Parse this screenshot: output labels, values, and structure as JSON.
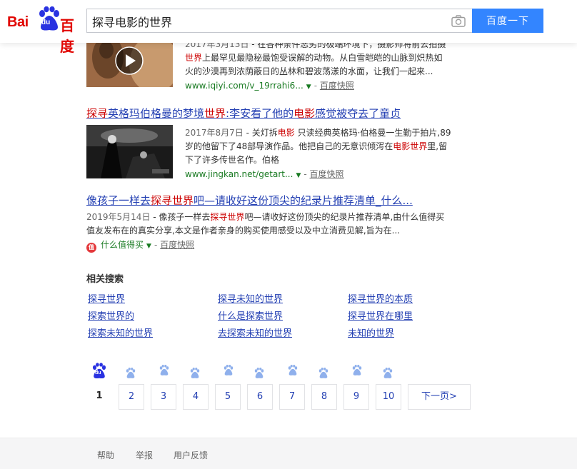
{
  "header": {
    "logo_bai": "Bai",
    "logo_du": "du",
    "logo_cn": "百度",
    "query": "探寻电影的世界",
    "search_button": "百度一下"
  },
  "results": [
    {
      "date": "2017年3月13日",
      "abstract_lines": [
        " - 在各种条件恶劣的极端环境下，摄影师将前去拍摄",
        "世界上最罕见最隐秘最饱受误解的动物。从白雪皑皑的山脉到炽热如",
        "火的沙漠再到浓荫蔽日的丛林和碧波荡漾的水面，让我们一起来..."
      ],
      "abstract_em": "世界",
      "url": "www.iqiyi.com/v_19rrahi6...",
      "snapshot": "百度快照"
    },
    {
      "title_parts": [
        "探寻",
        "英格玛伯格曼的梦境",
        "世界",
        ":李安看了他的",
        "电影",
        "感觉被夺去了童贞"
      ],
      "date": "2017年8月7日",
      "abstract_lines": [
        " - 关灯拆电影 只读经典英格玛·伯格曼一生勤于拍片,89",
        "岁的他留下了48部导演作品。他把自己的无意识倾泻在电影世界里,留",
        "下了许多传世名作。伯格"
      ],
      "url": "www.jingkan.net/getart...",
      "snapshot": "百度快照"
    },
    {
      "title_parts": [
        "像孩子一样去",
        "探寻世界",
        "吧—请收好这份顶尖的纪录片推荐清单_什么..."
      ],
      "date": "2019年5月14日",
      "abstract_lines": [
        " - 像孩子一样去探寻世界吧—请收好这份顶尖的纪录片推荐清单,由什么值得买",
        "值友发布在的真实分享,本文是作者亲身的购买使用感受以及中立消费见解,旨为在..."
      ],
      "source_icon": "值",
      "source_name": "什么值得买",
      "snapshot": "百度快照"
    }
  ],
  "related": {
    "title": "相关搜索",
    "items": [
      "探寻世界",
      "探寻未知的世界",
      "探寻世界的本质",
      "探索世界的",
      "什么是探索世界",
      "探寻世界在哪里",
      "探索未知的世界",
      "去探索未知的世界",
      "未知的世界"
    ]
  },
  "pagination": {
    "pages": [
      "1",
      "2",
      "3",
      "4",
      "5",
      "6",
      "7",
      "8",
      "9",
      "10"
    ],
    "current": "1",
    "next": "下一页>"
  },
  "footer": {
    "links": [
      "帮助",
      "举报",
      "用户反馈"
    ]
  },
  "colors": {
    "brand_red": "#e10602",
    "brand_blue": "#2932e1",
    "button_blue": "#3385ff",
    "link_blue": "#2440b3",
    "url_green": "#1a7b23",
    "highlight_red": "#c00"
  },
  "icons": [
    "baidu-paw-icon",
    "camera-icon",
    "play-icon",
    "dropdown-arrow-icon",
    "smzdm-icon",
    "pager-paw-icon"
  ]
}
